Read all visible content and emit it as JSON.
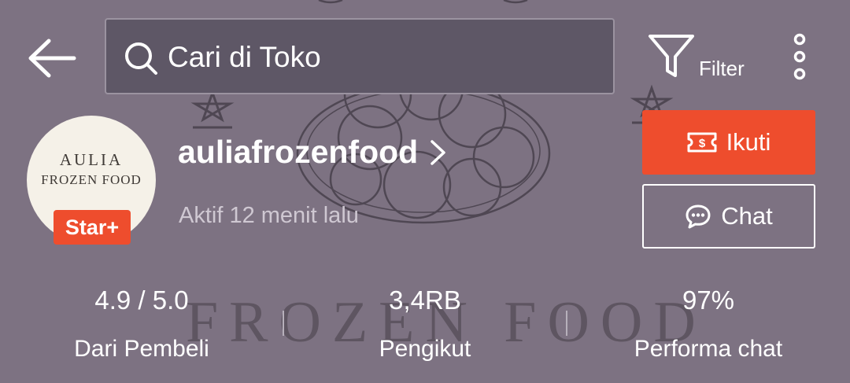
{
  "header": {
    "search": {
      "placeholder": "Cari di Toko"
    },
    "filter_label": "Filter"
  },
  "shop": {
    "avatar_logo": {
      "line1": "AULIA",
      "line2": "FROZEN FOOD"
    },
    "badge": "Star+",
    "name": "auliafrozenfood",
    "active_status": "Aktif 12 menit lalu",
    "follow_label": "Ikuti",
    "chat_label": "Chat"
  },
  "stats": [
    {
      "value": "4.9 / 5.0",
      "label": "Dari Pembeli"
    },
    {
      "value": "3,4RB",
      "label": "Pengikut"
    },
    {
      "value": "97%",
      "label": "Performa chat"
    }
  ],
  "background": {
    "wordmark": "FROZEN FOOD"
  },
  "colors": {
    "overlay": "#7d7282",
    "accent": "#ee4d2d",
    "search_bg": "#5e5766"
  }
}
